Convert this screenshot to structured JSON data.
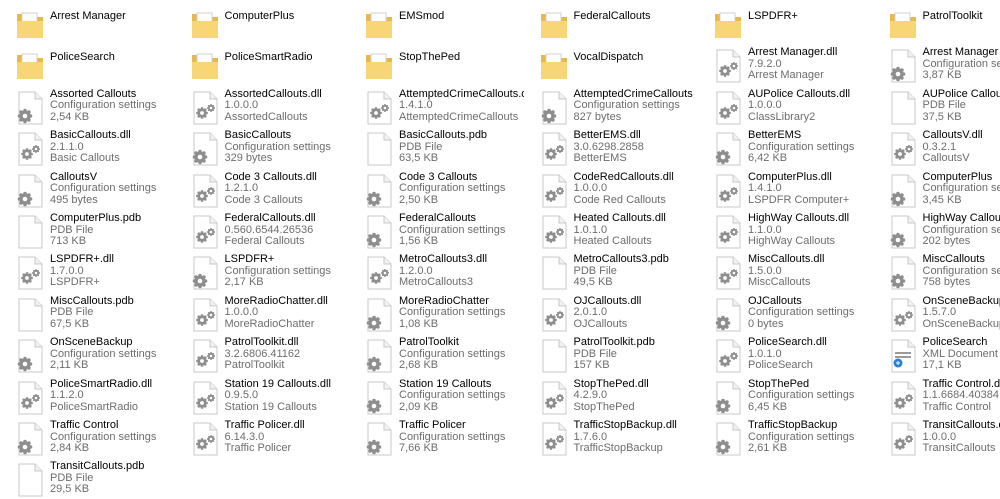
{
  "files": [
    {
      "name": "Arrest Manager",
      "type": "folder"
    },
    {
      "name": "ComputerPlus",
      "type": "folder"
    },
    {
      "name": "EMSmod",
      "type": "folder"
    },
    {
      "name": "FederalCallouts",
      "type": "folder"
    },
    {
      "name": "LSPDFR+",
      "type": "folder"
    },
    {
      "name": "PatrolToolkit",
      "type": "folder"
    },
    {
      "name": "PoliceSearch",
      "type": "folder"
    },
    {
      "name": "PoliceSmartRadio",
      "type": "folder"
    },
    {
      "name": "StopThePed",
      "type": "folder"
    },
    {
      "name": "VocalDispatch",
      "type": "folder"
    },
    {
      "name": "Arrest Manager.dll",
      "type": "dll",
      "line1": "7.9.2.0",
      "line2": "Arrest Manager"
    },
    {
      "name": "Arrest Manager",
      "type": "config",
      "line1": "Configuration settings",
      "line2": "3,87 KB"
    },
    {
      "name": "Assorted Callouts",
      "type": "config",
      "line1": "Configuration settings",
      "line2": "2,54 KB"
    },
    {
      "name": "AssortedCallouts.dll",
      "type": "dll",
      "line1": "1.0.0.0",
      "line2": "AssortedCallouts"
    },
    {
      "name": "AttemptedCrimeCallouts.dll",
      "type": "dll",
      "line1": "1.4.1.0",
      "line2": "AttemptedCrimeCallouts"
    },
    {
      "name": "AttemptedCrimeCallouts",
      "type": "config",
      "line1": "Configuration settings",
      "line2": "827 bytes"
    },
    {
      "name": "AUPolice Callouts.dll",
      "type": "dll",
      "line1": "1.0.0.0",
      "line2": "ClassLibrary2"
    },
    {
      "name": "AUPolice Callouts.pdb",
      "type": "pdb",
      "line1": "PDB File",
      "line2": "37,5 KB"
    },
    {
      "name": "BasicCallouts.dll",
      "type": "dll",
      "line1": "2.1.1.0",
      "line2": "Basic Callouts"
    },
    {
      "name": "BasicCallouts",
      "type": "config",
      "line1": "Configuration settings",
      "line2": "329 bytes"
    },
    {
      "name": "BasicCallouts.pdb",
      "type": "pdb",
      "line1": "PDB File",
      "line2": "63,5 KB"
    },
    {
      "name": "BetterEMS.dll",
      "type": "dll",
      "line1": "3.0.6298.2858",
      "line2": "BetterEMS"
    },
    {
      "name": "BetterEMS",
      "type": "config",
      "line1": "Configuration settings",
      "line2": "6,42 KB"
    },
    {
      "name": "CalloutsV.dll",
      "type": "dll",
      "line1": "0.3.2.1",
      "line2": "CalloutsV"
    },
    {
      "name": "CalloutsV",
      "type": "config",
      "line1": "Configuration settings",
      "line2": "495 bytes"
    },
    {
      "name": "Code 3 Callouts.dll",
      "type": "dll",
      "line1": "1.2.1.0",
      "line2": "Code 3 Callouts"
    },
    {
      "name": "Code 3 Callouts",
      "type": "config",
      "line1": "Configuration settings",
      "line2": "2,50 KB"
    },
    {
      "name": "CodeRedCallouts.dll",
      "type": "dll",
      "line1": "1.0.0.0",
      "line2": "Code Red Callouts"
    },
    {
      "name": "ComputerPlus.dll",
      "type": "dll",
      "line1": "1.4.1.0",
      "line2": "LSPDFR Computer+"
    },
    {
      "name": "ComputerPlus",
      "type": "config",
      "line1": "Configuration settings",
      "line2": "3,45 KB"
    },
    {
      "name": "ComputerPlus.pdb",
      "type": "pdb",
      "line1": "PDB File",
      "line2": "713 KB"
    },
    {
      "name": "FederalCallouts.dll",
      "type": "dll",
      "line1": "0.560.6544.26536",
      "line2": "Federal Callouts"
    },
    {
      "name": "FederalCallouts",
      "type": "config",
      "line1": "Configuration settings",
      "line2": "1,56 KB"
    },
    {
      "name": "Heated Callouts.dll",
      "type": "dll",
      "line1": "1.0.1.0",
      "line2": "Heated Callouts"
    },
    {
      "name": "HighWay Callouts.dll",
      "type": "dll",
      "line1": "1.1.0.0",
      "line2": "HighWay Callouts"
    },
    {
      "name": "HighWay Callouts",
      "type": "config",
      "line1": "Configuration settings",
      "line2": "202 bytes"
    },
    {
      "name": "LSPDFR+.dll",
      "type": "dll",
      "line1": "1.7.0.0",
      "line2": "LSPDFR+"
    },
    {
      "name": "LSPDFR+",
      "type": "config",
      "line1": "Configuration settings",
      "line2": "2,17 KB"
    },
    {
      "name": "MetroCallouts3.dll",
      "type": "dll",
      "line1": "1.2.0.0",
      "line2": "MetroCallouts3"
    },
    {
      "name": "MetroCallouts3.pdb",
      "type": "pdb",
      "line1": "PDB File",
      "line2": "49,5 KB"
    },
    {
      "name": "MiscCallouts.dll",
      "type": "dll",
      "line1": "1.5.0.0",
      "line2": "MiscCallouts"
    },
    {
      "name": "MiscCallouts",
      "type": "config",
      "line1": "Configuration settings",
      "line2": "758 bytes"
    },
    {
      "name": "MiscCallouts.pdb",
      "type": "pdb",
      "line1": "PDB File",
      "line2": "67,5 KB"
    },
    {
      "name": "MoreRadioChatter.dll",
      "type": "dll",
      "line1": "1.0.0.0",
      "line2": "MoreRadioChatter"
    },
    {
      "name": "MoreRadioChatter",
      "type": "config",
      "line1": "Configuration settings",
      "line2": "1,08 KB"
    },
    {
      "name": "OJCallouts.dll",
      "type": "dll",
      "line1": "2.0.1.0",
      "line2": "OJCallouts"
    },
    {
      "name": "OJCallouts",
      "type": "config",
      "line1": "Configuration settings",
      "line2": "0 bytes"
    },
    {
      "name": "OnSceneBackup.dll",
      "type": "dll",
      "line1": "1.5.7.0",
      "line2": "OnSceneBackup"
    },
    {
      "name": "OnSceneBackup",
      "type": "config",
      "line1": "Configuration settings",
      "line2": "2,11 KB"
    },
    {
      "name": "PatrolToolkit.dll",
      "type": "dll",
      "line1": "3.2.6806.41162",
      "line2": "PatrolToolkit"
    },
    {
      "name": "PatrolToolkit",
      "type": "config",
      "line1": "Configuration settings",
      "line2": "2,68 KB"
    },
    {
      "name": "PatrolToolkit.pdb",
      "type": "pdb",
      "line1": "PDB File",
      "line2": "157 KB"
    },
    {
      "name": "PoliceSearch.dll",
      "type": "dll",
      "line1": "1.0.1.0",
      "line2": "PoliceSearch"
    },
    {
      "name": "PoliceSearch",
      "type": "xml",
      "line1": "XML Document",
      "line2": "17,1 KB"
    },
    {
      "name": "PoliceSmartRadio.dll",
      "type": "dll",
      "line1": "1.1.2.0",
      "line2": "PoliceSmartRadio"
    },
    {
      "name": "Station 19 Callouts.dll",
      "type": "dll",
      "line1": "0.9.5.0",
      "line2": "Station 19 Callouts"
    },
    {
      "name": "Station 19 Callouts",
      "type": "config",
      "line1": "Configuration settings",
      "line2": "2,09 KB"
    },
    {
      "name": "StopThePed.dll",
      "type": "dll",
      "line1": "4.2.9.0",
      "line2": "StopThePed"
    },
    {
      "name": "StopThePed",
      "type": "config",
      "line1": "Configuration settings",
      "line2": "6,45 KB"
    },
    {
      "name": "Traffic Control.dll",
      "type": "dll",
      "line1": "1.1.6684.40384",
      "line2": "Traffic Control"
    },
    {
      "name": "Traffic Control",
      "type": "config",
      "line1": "Configuration settings",
      "line2": "2,84 KB"
    },
    {
      "name": "Traffic Policer.dll",
      "type": "dll",
      "line1": "6.14.3.0",
      "line2": "Traffic Policer"
    },
    {
      "name": "Traffic Policer",
      "type": "config",
      "line1": "Configuration settings",
      "line2": "7,66 KB"
    },
    {
      "name": "TrafficStopBackup.dll",
      "type": "dll",
      "line1": "1.7.6.0",
      "line2": "TrafficStopBackup"
    },
    {
      "name": "TrafficStopBackup",
      "type": "config",
      "line1": "Configuration settings",
      "line2": "2,61 KB"
    },
    {
      "name": "TransitCallouts.dll",
      "type": "dll",
      "line1": "1.0.0.0",
      "line2": "TransitCallouts"
    },
    {
      "name": "TransitCallouts.pdb",
      "type": "pdb",
      "line1": "PDB File",
      "line2": "29,5 KB"
    }
  ],
  "colors": {
    "folder_back": "#e8b84a",
    "folder_front": "#f8d675",
    "paper": "#ffffff",
    "paper_border": "#c8c8c8",
    "gear": "#8e8e8e",
    "xml_accent": "#2a7fd4"
  }
}
